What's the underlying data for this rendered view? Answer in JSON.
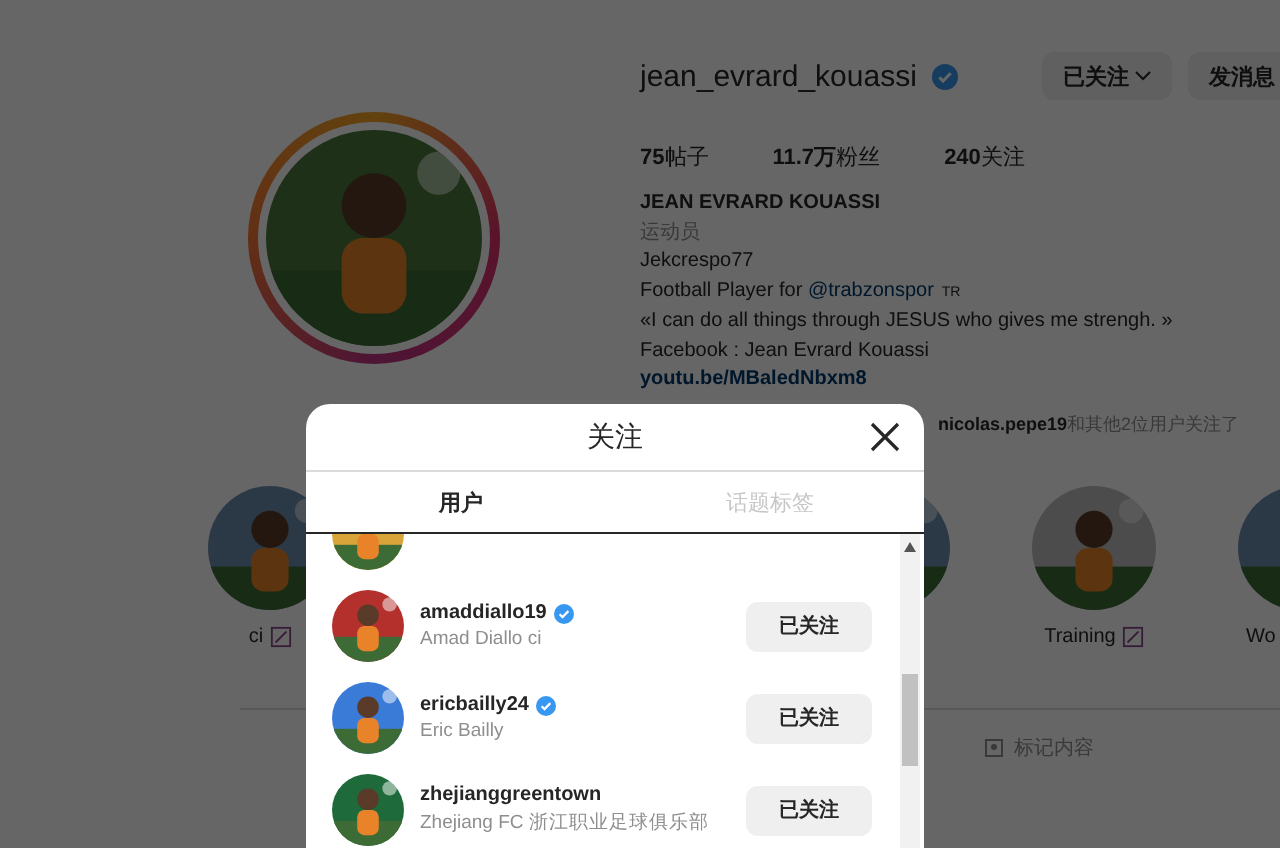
{
  "profile": {
    "username": "jean_evrard_kouassi",
    "verified": true,
    "follow_button": "已关注",
    "message_button": "发消息",
    "stats": [
      "**75**帖子",
      "**11.7万**粉丝",
      "**240**关注"
    ],
    "full_name": "JEAN EVRARD KOUASSI",
    "category": "运动员",
    "bio": [
      {
        "kind": "text",
        "text": "Jekcrespo77"
      },
      {
        "kind": "mention",
        "text": "Football Player for ",
        "link": "@trabzonspor",
        "flag": "TR"
      },
      {
        "kind": "text",
        "text": "«I can do all things through JESUS who gives me strengh. »"
      },
      {
        "kind": "text",
        "text": "Facebook : Jean Evrard Kouassi"
      },
      {
        "kind": "link",
        "text": "youtu.be/MBaledNbxm8"
      }
    ],
    "followed_by": {
      "user": "nicolas.pepe19",
      "rest": "和其他2位用户关注了"
    }
  },
  "highlights": [
    {
      "kind": "labeled",
      "label": "ci",
      "icon": true
    },
    {
      "kind": "picture"
    },
    {
      "kind": "labeled",
      "label": "Training",
      "icon": true
    },
    {
      "kind": "labeled",
      "label": "Wo"
    }
  ],
  "tagged_tab": "标记内容",
  "modal": {
    "title": "关注",
    "tabs": [
      {
        "label": "用户",
        "selected": true
      },
      {
        "label": "话题标签",
        "selected": false
      }
    ],
    "rows": [
      {
        "kind": "partial"
      },
      {
        "kind": "account",
        "username": "amaddiallo19",
        "name": "Amad Diallo ci",
        "verified": true,
        "button": "已关注"
      },
      {
        "kind": "account",
        "username": "ericbailly24",
        "name": "Eric Bailly",
        "verified": true,
        "button": "已关注"
      },
      {
        "kind": "account",
        "username": "zhejianggreentown",
        "name": "Zhejiang FC 浙江职业足球俱乐部",
        "verified": false,
        "button": "已关注"
      }
    ]
  }
}
